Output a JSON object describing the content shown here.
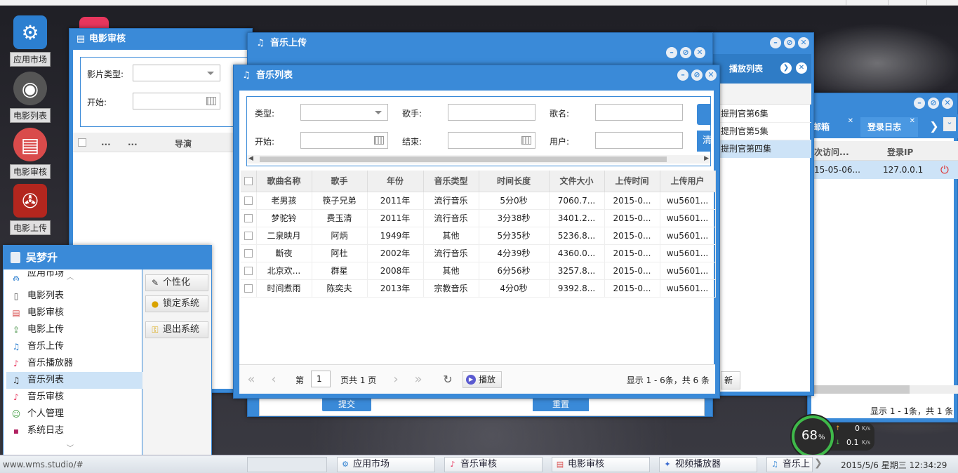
{
  "desktop_icons": [
    {
      "label": "应用市场",
      "icon": "gear-icon"
    },
    {
      "label": "电影列表",
      "icon": "disc-icon"
    },
    {
      "label": "电影审核",
      "icon": "film-icon"
    },
    {
      "label": "电影上传",
      "icon": "film-reel-icon"
    }
  ],
  "movie_review_window": {
    "title": "电影审核",
    "type_label": "影片类型:",
    "start_label": "开始:",
    "columns": [
      "...",
      "...",
      "导演"
    ]
  },
  "music_upload_window": {
    "title": "音乐上传",
    "submit_label": "提交",
    "reset_label": "重置"
  },
  "playlist_window": {
    "title": "播放列表",
    "items": [
      "提刑官第6集",
      "提刑官第5集",
      "提刑官第四集"
    ],
    "refresh_partial": "新"
  },
  "log_window": {
    "tabs": [
      "邮箱",
      "登录日志"
    ],
    "columns": [
      "次访问...",
      "登录IP"
    ],
    "row": {
      "date": "15-05-06...",
      "ip": "127.0.0.1"
    },
    "status": "显示 1 - 1条，共 1 条"
  },
  "music_list_window": {
    "title": "音乐列表",
    "filters": {
      "type_label": "类型:",
      "singer_label": "歌手:",
      "song_label": "歌名:",
      "start_label": "开始:",
      "end_label": "结束:",
      "user_label": "用户:",
      "reset_partial": "清"
    },
    "columns": [
      "歌曲名称",
      "歌手",
      "年份",
      "音乐类型",
      "时间长度",
      "文件大小",
      "上传时间",
      "上传用户"
    ],
    "rows": [
      [
        "老男孩",
        "筷子兄弟",
        "2011年",
        "流行音乐",
        "5分0秒",
        "7060.7...",
        "2015-0...",
        "wu5601..."
      ],
      [
        "梦驼铃",
        "费玉清",
        "2011年",
        "流行音乐",
        "3分38秒",
        "3401.2...",
        "2015-0...",
        "wu5601..."
      ],
      [
        "二泉映月",
        "阿炳",
        "1949年",
        "其他",
        "5分35秒",
        "5236.8...",
        "2015-0...",
        "wu5601..."
      ],
      [
        "斷夜",
        "阿杜",
        "2002年",
        "流行音乐",
        "4分39秒",
        "4360.0...",
        "2015-0...",
        "wu5601..."
      ],
      [
        "北京欢...",
        "群星",
        "2008年",
        "其他",
        "6分56秒",
        "3257.8...",
        "2015-0...",
        "wu5601..."
      ],
      [
        "时间煮雨",
        "陈奕夫",
        "2013年",
        "宗教音乐",
        "4分0秒",
        "9392.8...",
        "2015-0...",
        "wu5601..."
      ]
    ],
    "pager": {
      "page_prefix": "第",
      "page_value": "1",
      "page_suffix": "页共 1 页",
      "play_label": "播放",
      "status": "显示 1 - 6条，共 6 条"
    }
  },
  "start_menu": {
    "user": "吴梦升",
    "items": [
      {
        "label": "应用市场",
        "icon": "gear-icon"
      },
      {
        "label": "电影列表",
        "icon": "list-icon"
      },
      {
        "label": "电影审核",
        "icon": "film-icon"
      },
      {
        "label": "电影上传",
        "icon": "upload-icon"
      },
      {
        "label": "音乐上传",
        "icon": "music-upload-icon"
      },
      {
        "label": "音乐播放器",
        "icon": "music-note-icon"
      },
      {
        "label": "音乐列表",
        "icon": "music-list-icon"
      },
      {
        "label": "音乐审核",
        "icon": "music-review-icon"
      },
      {
        "label": "个人管理",
        "icon": "person-icon"
      },
      {
        "label": "系统日志",
        "icon": "log-icon"
      }
    ],
    "personalize": "个性化",
    "lock": "锁定系统",
    "logout": "退出系统"
  },
  "speed_widget": {
    "percent": "68",
    "up": "0",
    "down": "0.1",
    "unit": "K/s"
  },
  "taskbar": {
    "url": "www.wms.studio/#",
    "tasks": [
      "应用市场",
      "音乐审核",
      "电影审核",
      "视频播放器",
      "音乐上传"
    ],
    "clock": "2015/5/6 星期三 12:34:29"
  },
  "colors": {
    "window_blue": "#3a8ad8",
    "selected_row": "#cde3f7"
  }
}
